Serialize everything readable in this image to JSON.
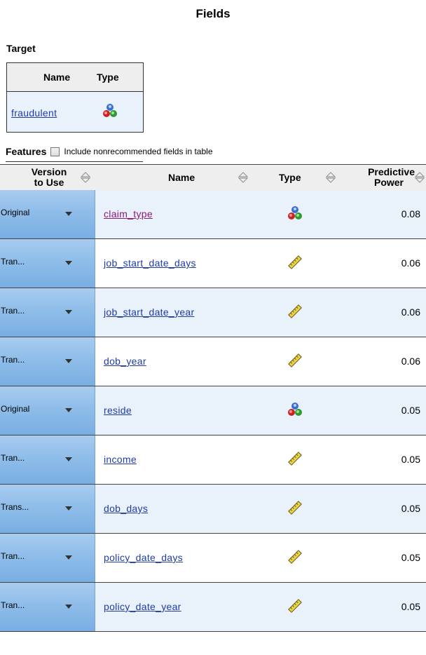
{
  "page": {
    "title": "Fields"
  },
  "target": {
    "section_label": "Target",
    "columns": {
      "name": "Name",
      "type": "Type"
    },
    "row": {
      "name": "fraudulent",
      "type_icon": "nominal-icon"
    }
  },
  "features": {
    "section_label": "Features",
    "checkbox_label": "Include nonrecommended fields in table",
    "checkbox_checked": false,
    "columns": {
      "version_line1": "Version",
      "version_line2": "to Use",
      "name": "Name",
      "type": "Type",
      "power_line1": "Predictive",
      "power_line2": "Power"
    },
    "rows": [
      {
        "version": "Original",
        "name": "claim_type",
        "type_icon": "nominal-icon",
        "power": "0.08",
        "visited": true
      },
      {
        "version": "Tran...",
        "name": "job_start_date_days",
        "type_icon": "continuous-icon",
        "power": "0.06",
        "visited": false
      },
      {
        "version": "Tran...",
        "name": "job_start_date_year",
        "type_icon": "continuous-icon",
        "power": "0.06",
        "visited": false
      },
      {
        "version": "Tran...",
        "name": "dob_year",
        "type_icon": "continuous-icon",
        "power": "0.06",
        "visited": false
      },
      {
        "version": "Original",
        "name": "reside",
        "type_icon": "nominal-icon",
        "power": "0.05",
        "visited": false
      },
      {
        "version": "Tran...",
        "name": "income",
        "type_icon": "continuous-icon",
        "power": "0.05",
        "visited": false
      },
      {
        "version": "Trans...",
        "name": "dob_days",
        "type_icon": "continuous-icon",
        "power": "0.05",
        "visited": false
      },
      {
        "version": "Tran...",
        "name": "policy_date_days",
        "type_icon": "continuous-icon",
        "power": "0.05",
        "visited": false
      },
      {
        "version": "Tran...",
        "name": "policy_date_year",
        "type_icon": "continuous-icon",
        "power": "0.05",
        "visited": false
      }
    ]
  },
  "colors": {
    "link": "#1f3ca8",
    "visited_link": "#8b1a7a",
    "row_alt": "#e9f1fb",
    "version_cell": "#8fbde9"
  }
}
